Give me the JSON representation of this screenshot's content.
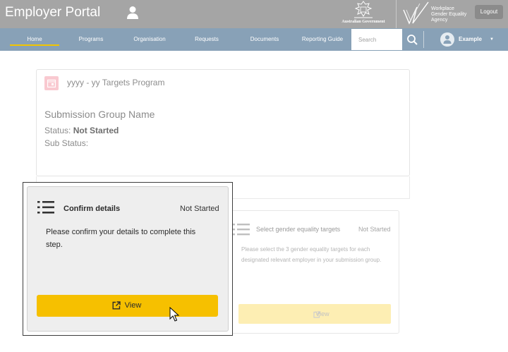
{
  "header": {
    "app_title": "Employer Portal",
    "crest_label": "Australian Government",
    "agency_lines": [
      "Workplace",
      "Gender Equality",
      "Agency"
    ],
    "logout_label": "Logout",
    "colors": {
      "top_bar": "#a5a5a5",
      "nav_bar": "#88a1b7",
      "active_underline": "#f2c500"
    }
  },
  "nav": {
    "items": [
      {
        "label": "Home",
        "active": true
      },
      {
        "label": "Programs",
        "active": false
      },
      {
        "label": "Organisation",
        "active": false
      },
      {
        "label": "Requests",
        "active": false
      },
      {
        "label": "Documents",
        "active": false
      },
      {
        "label": "Reporting Guide",
        "active": false
      }
    ],
    "search_placeholder": "Search",
    "user_name": "Example"
  },
  "program_card": {
    "icon": "calendar-icon",
    "title": "yyyy - yy Targets Program",
    "group_name": "Submission Group Name",
    "status_label": "Status:",
    "status_value": "Not Started",
    "sub_status_label": "Sub Status:"
  },
  "faded_step": {
    "icon": "list-icon",
    "title": "Select gender equality targets",
    "status": "Not Started",
    "description": "Please select the 3 gender equality targets for each designated relevant employer in your submission group.",
    "view_label": "View"
  },
  "focused_step": {
    "icon": "list-icon",
    "title": "Confirm details",
    "status": "Not Started",
    "description": "Please confirm your details to complete this step.",
    "view_label": "View",
    "button_color": "#f6c000"
  }
}
